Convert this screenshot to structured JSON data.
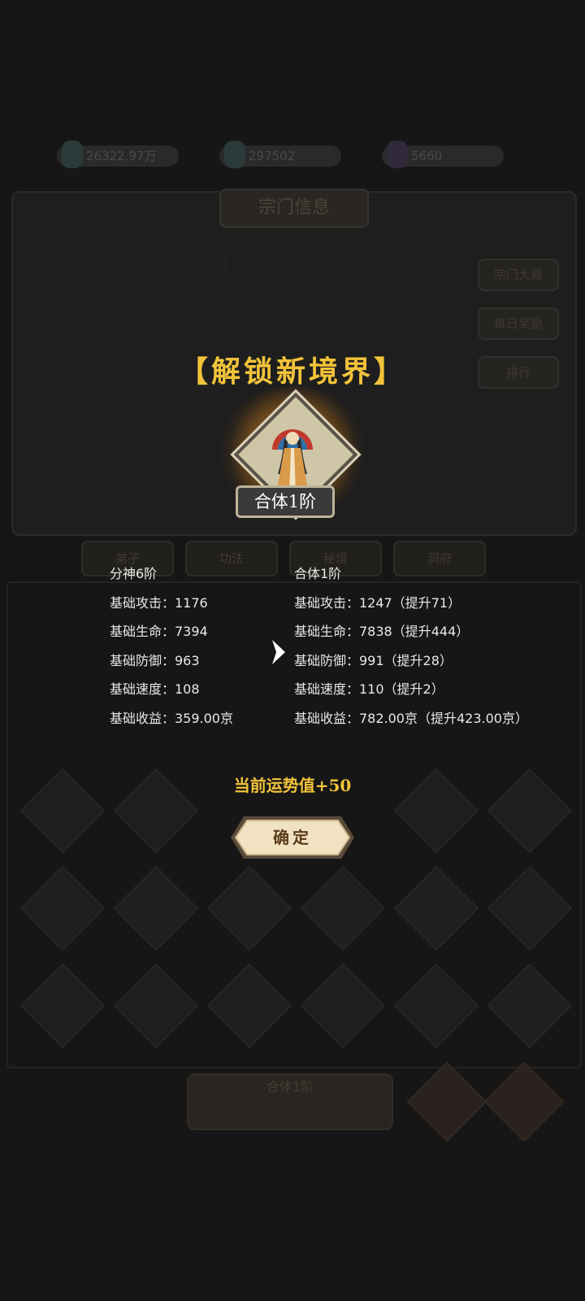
{
  "background": {
    "resources": [
      "26322.97万",
      "297502",
      "5660"
    ],
    "panel_title": "宗门信息",
    "side_buttons": [
      "宗门大殿",
      "每日奖励",
      "排行"
    ],
    "tabs": [
      "弟子",
      "功法",
      "秘境",
      "洞府"
    ],
    "bottom_button": "合体1阶"
  },
  "modal": {
    "title": "【解锁新境界】",
    "new_rank": "合体1阶",
    "current": {
      "header": "分神6阶",
      "stats": [
        "基础攻击：1176",
        "基础生命：7394",
        "基础防御：963",
        "基础速度：108",
        "基础收益：359.00京"
      ]
    },
    "next": {
      "header": "合体1阶",
      "stats": [
        "基础攻击：1247（提升71）",
        "基础生命：7838（提升444）",
        "基础防御：991（提升28）",
        "基础速度：110（提升2）",
        "基础收益：782.00京（提升423.00京）"
      ]
    },
    "fortune": "当前运势值+50",
    "confirm_label": "确定"
  },
  "colors": {
    "accent_gold": "#f2c33a",
    "overlay_bg": "#161616",
    "button_cream": "#f1e3c2"
  },
  "icons": [
    "arrow-right-icon",
    "cultivator-portrait-icon"
  ]
}
